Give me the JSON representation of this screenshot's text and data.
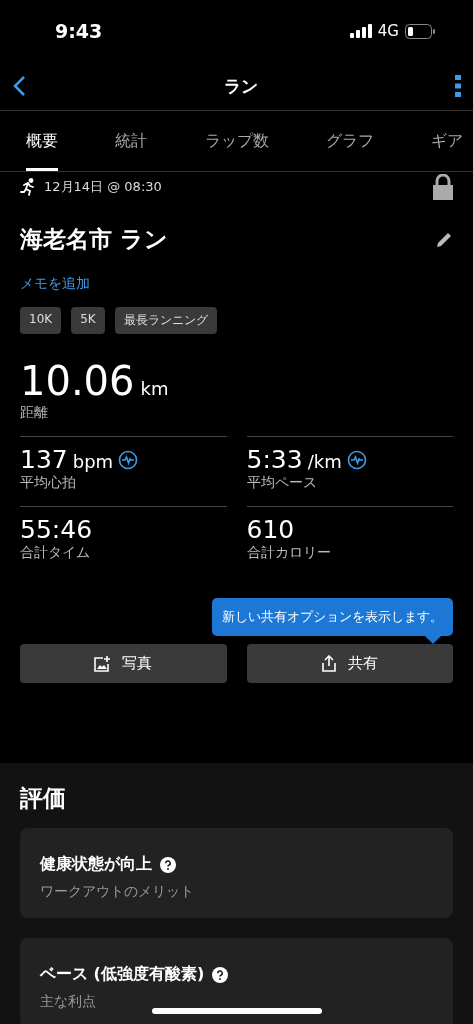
{
  "status_bar": {
    "time": "9:43",
    "network": "4G"
  },
  "nav": {
    "title": "ラン"
  },
  "tabs": [
    {
      "label": "概要",
      "selected": true
    },
    {
      "label": "統計",
      "selected": false
    },
    {
      "label": "ラップ数",
      "selected": false
    },
    {
      "label": "グラフ",
      "selected": false
    },
    {
      "label": "ギア",
      "selected": false
    }
  ],
  "activity": {
    "date": "12月14日 @ 08:30",
    "title": "海老名市 ラン",
    "add_note": "メモを追加",
    "tags": [
      "10K",
      "5K",
      "最長ランニング"
    ],
    "distance": {
      "value": "10.06",
      "unit": "km",
      "label": "距離"
    }
  },
  "stats": [
    {
      "kind": "graph",
      "value": "137",
      "unit": "bpm",
      "label": "平均心拍"
    },
    {
      "kind": "graph",
      "value": "5:33",
      "unit": "/km",
      "label": "平均ペース"
    },
    {
      "kind": "plain",
      "value": "55:46",
      "label": "合計タイム"
    },
    {
      "kind": "plain",
      "value": "610",
      "label": "合計カロリー"
    }
  ],
  "tooltip": "新しい共有オプションを表示します。",
  "buttons": [
    {
      "kind": "photo",
      "label": "写真"
    },
    {
      "kind": "share",
      "label": "共有"
    }
  ],
  "evaluation": {
    "heading": "評価",
    "cards": [
      {
        "title": "健康状態が向上",
        "subtitle": "ワークアウトのメリット"
      },
      {
        "title": "ベース (低強度有酸素)",
        "subtitle": "主な利点"
      }
    ]
  }
}
